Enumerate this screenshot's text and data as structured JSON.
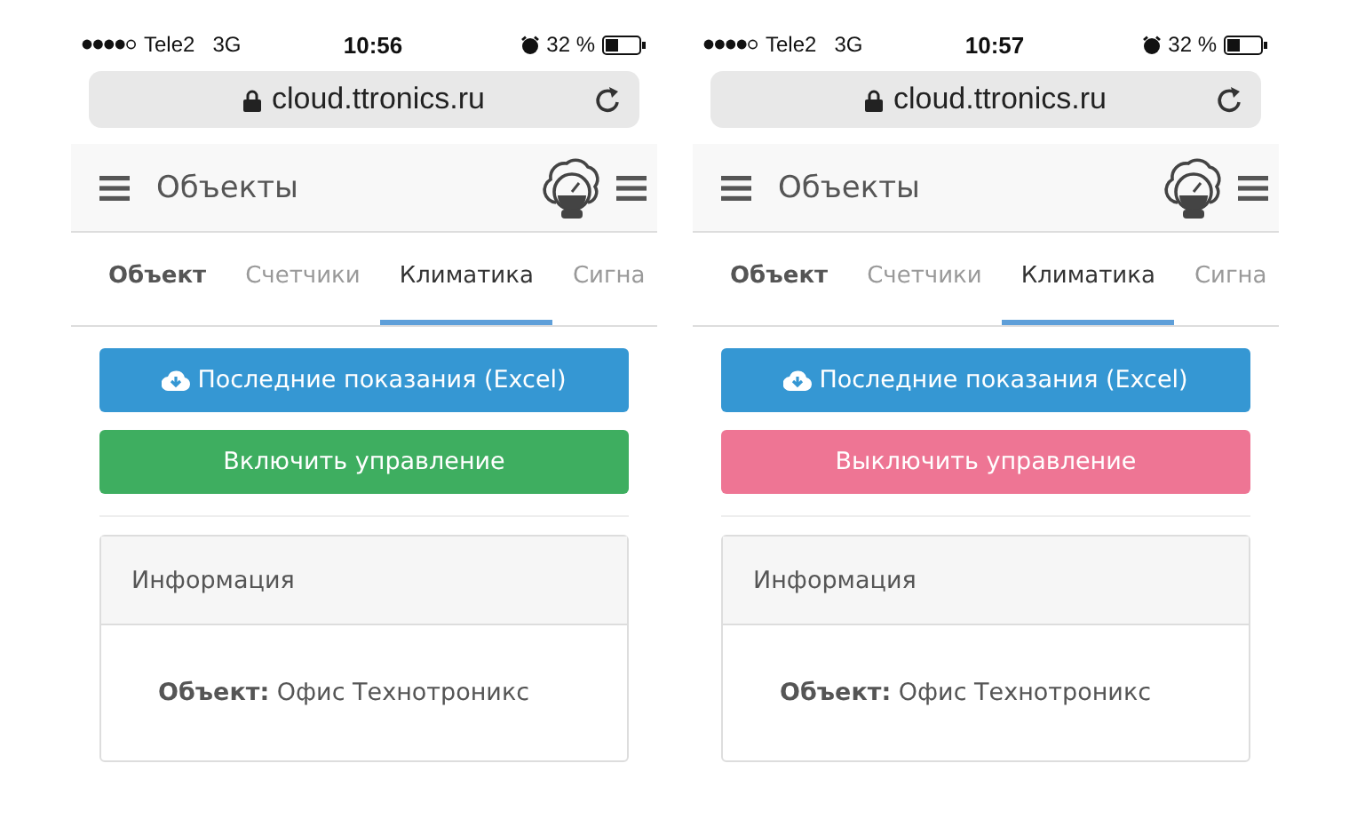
{
  "phones": [
    {
      "status_bar": {
        "carrier": "Tele2",
        "network": "3G",
        "time": "10:56",
        "battery": "32 %"
      },
      "address_bar": {
        "url": "cloud.ttronics.ru"
      },
      "header": {
        "title": "Объекты"
      },
      "tabs": [
        {
          "label": "Объект",
          "bold": true,
          "selected": false
        },
        {
          "label": "Счетчики",
          "bold": false,
          "selected": false
        },
        {
          "label": "Климатика",
          "bold": false,
          "selected": true
        },
        {
          "label": "Сигна",
          "bold": false,
          "selected": false
        }
      ],
      "buttons": [
        {
          "label": "Последние показания (Excel)",
          "kind": "download"
        },
        {
          "label": "Включить управление",
          "kind": "enable"
        }
      ],
      "info_card": {
        "heading": "Информация",
        "text": "**Объект:** Офис Технотроникс"
      }
    },
    {
      "status_bar": {
        "carrier": "Tele2",
        "network": "3G",
        "time": "10:57",
        "battery": "32 %"
      },
      "address_bar": {
        "url": "cloud.ttronics.ru"
      },
      "header": {
        "title": "Объекты"
      },
      "tabs": [
        {
          "label": "Объект",
          "bold": true,
          "selected": false
        },
        {
          "label": "Счетчики",
          "bold": false,
          "selected": false
        },
        {
          "label": "Климатика",
          "bold": false,
          "selected": true
        },
        {
          "label": "Сигна",
          "bold": false,
          "selected": false
        }
      ],
      "buttons": [
        {
          "label": "Последние показания (Excel)",
          "kind": "download"
        },
        {
          "label": "Выключить управление",
          "kind": "disable"
        }
      ],
      "info_card": {
        "heading": "Информация",
        "text": "**Объект:** Офис Технотроникс"
      }
    }
  ]
}
